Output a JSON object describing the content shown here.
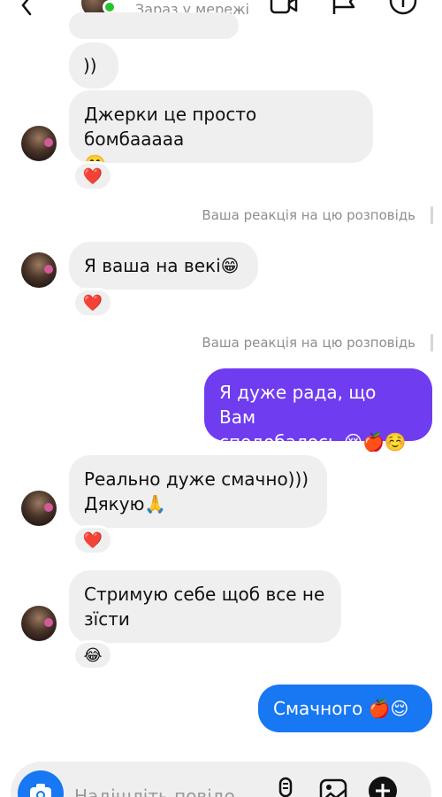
{
  "header": {
    "status": "Зараз у мережі",
    "online_color": "#22c32e",
    "icons": [
      "back-icon",
      "video-call-icon",
      "flag-icon",
      "info-icon"
    ]
  },
  "messages": [
    {
      "id": "m1",
      "direction": "incoming",
      "text": "))"
    },
    {
      "id": "m2",
      "direction": "incoming",
      "text": "Джерки це просто бомбааааа\n🤭",
      "reaction": "❤️"
    },
    {
      "id": "m3",
      "direction": "incoming",
      "text": "Я ваша на векі😁",
      "reaction": "❤️",
      "story_note": "Ваша реакція на цю розповідь"
    },
    {
      "id": "m4",
      "direction": "outgoing",
      "text": "Я дуже рада, що Вам\nсподобалось 😌🍎☺️",
      "story_note": "Ваша реакція на цю розповідь"
    },
    {
      "id": "m5",
      "direction": "incoming",
      "text": "Реально дуже смачно)))\nДякую🙏",
      "reaction": "❤️"
    },
    {
      "id": "m6",
      "direction": "incoming",
      "text": "Стримую себе щоб все не\nзїсти",
      "reaction": "😂"
    },
    {
      "id": "m7",
      "direction": "outgoing",
      "text": "Смачного 🍎😌"
    }
  ],
  "composer": {
    "placeholder": "Надішліть повідо",
    "icons": [
      "camera-icon",
      "microphone-icon",
      "image-icon",
      "add-icon"
    ]
  },
  "colors": {
    "incoming_bubble": "#efefef",
    "outgoing_bubble_purple": "#6f3cf0",
    "outgoing_bubble_blue": "#1877f2",
    "muted_text": "#8e8e8e"
  }
}
